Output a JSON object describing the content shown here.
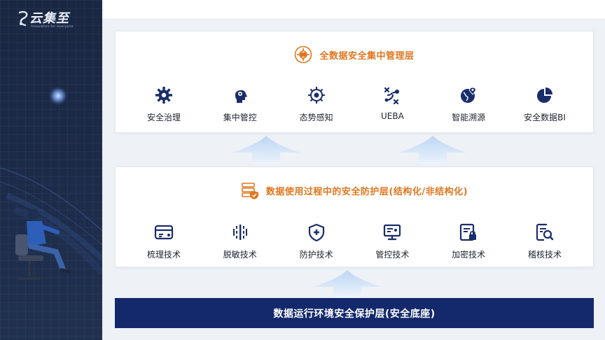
{
  "brand": {
    "name": "云集至",
    "tagline": "innovation for everyone"
  },
  "colors": {
    "sidebar": "#1c2b49",
    "accent_orange": "#e0771f",
    "icon_navy": "#1a2d6b",
    "bottom_bar": "#14296b"
  },
  "top_panel": {
    "title": "全数据安全集中管理层",
    "icon": "network-shield-icon",
    "items": [
      {
        "label": "安全治理",
        "icon": "gear-icon"
      },
      {
        "label": "集中管控",
        "icon": "head-gear-icon"
      },
      {
        "label": "态势感知",
        "icon": "radar-icon"
      },
      {
        "label": "UEBA",
        "icon": "path-icon"
      },
      {
        "label": "智能溯源",
        "icon": "globe-pin-icon"
      },
      {
        "label": "安全数据BI",
        "icon": "pie-chart-icon"
      }
    ]
  },
  "middle_panel": {
    "title": "数据使用过程中的安全防护层(结构化/非结构化)",
    "icon": "server-shield-icon",
    "items": [
      {
        "label": "梳理技术",
        "icon": "card-icon"
      },
      {
        "label": "脱敏技术",
        "icon": "mask-data-icon"
      },
      {
        "label": "防护技术",
        "icon": "shield-plus-icon"
      },
      {
        "label": "管控技术",
        "icon": "monitor-icon"
      },
      {
        "label": "加密技术",
        "icon": "lock-doc-icon"
      },
      {
        "label": "稽核技术",
        "icon": "search-doc-icon"
      }
    ]
  },
  "bottom_bar": {
    "title": "数据运行环境安全保护层(安全底座)"
  }
}
